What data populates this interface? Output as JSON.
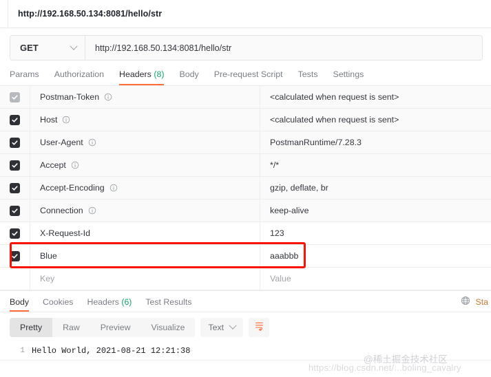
{
  "window": {
    "tab_title": "http://192.168.50.134:8081/hello/str"
  },
  "request": {
    "method": "GET",
    "url": "http://192.168.50.134:8081/hello/str",
    "tabs": [
      {
        "label": "Params",
        "active": false
      },
      {
        "label": "Authorization",
        "active": false
      },
      {
        "label": "Headers",
        "count": "(8)",
        "active": true
      },
      {
        "label": "Body",
        "active": false
      },
      {
        "label": "Pre-request Script",
        "active": false
      },
      {
        "label": "Tests",
        "active": false
      },
      {
        "label": "Settings",
        "active": false
      }
    ],
    "headers_table": {
      "key_placeholder": "Key",
      "value_placeholder": "Value",
      "rows": [
        {
          "checked": true,
          "disabled": true,
          "shaded": true,
          "info": true,
          "key": "Postman-Token",
          "value": "<calculated when request is sent>"
        },
        {
          "checked": true,
          "disabled": false,
          "shaded": true,
          "info": true,
          "key": "Host",
          "value": "<calculated when request is sent>"
        },
        {
          "checked": true,
          "disabled": false,
          "shaded": true,
          "info": true,
          "key": "User-Agent",
          "value": "PostmanRuntime/7.28.3"
        },
        {
          "checked": true,
          "disabled": false,
          "shaded": true,
          "info": true,
          "key": "Accept",
          "value": "*/*"
        },
        {
          "checked": true,
          "disabled": false,
          "shaded": true,
          "info": true,
          "key": "Accept-Encoding",
          "value": "gzip, deflate, br"
        },
        {
          "checked": true,
          "disabled": false,
          "shaded": true,
          "info": true,
          "key": "Connection",
          "value": "keep-alive"
        },
        {
          "checked": true,
          "disabled": false,
          "shaded": false,
          "info": false,
          "key": "X-Request-Id",
          "value": "123"
        },
        {
          "checked": true,
          "disabled": false,
          "shaded": false,
          "info": false,
          "key": "Blue",
          "value": "aaabbb"
        }
      ]
    }
  },
  "response": {
    "tabs": [
      {
        "label": "Body",
        "active": true
      },
      {
        "label": "Cookies",
        "active": false
      },
      {
        "label": "Headers",
        "count": "(6)",
        "active": false
      },
      {
        "label": "Test Results",
        "active": false
      }
    ],
    "status_label": "Sta",
    "viewer_modes": [
      {
        "label": "Pretty",
        "active": true
      },
      {
        "label": "Raw",
        "active": false
      },
      {
        "label": "Preview",
        "active": false
      },
      {
        "label": "Visualize",
        "active": false
      }
    ],
    "format": "Text",
    "body_lines": [
      {
        "no": "1",
        "text": "Hello World, 2021-08-21 12:21:38"
      }
    ]
  },
  "annotation": {
    "highlight_target": "Blue"
  },
  "watermarks": {
    "url": "https://blog.csdn.net/...boling_cavalry",
    "brand": "@稀土掘金技术社区"
  },
  "colors": {
    "accent": "#ff6c37",
    "count": "#15a46e",
    "annotation": "#fb1202",
    "checkbox": "#2f3137"
  }
}
